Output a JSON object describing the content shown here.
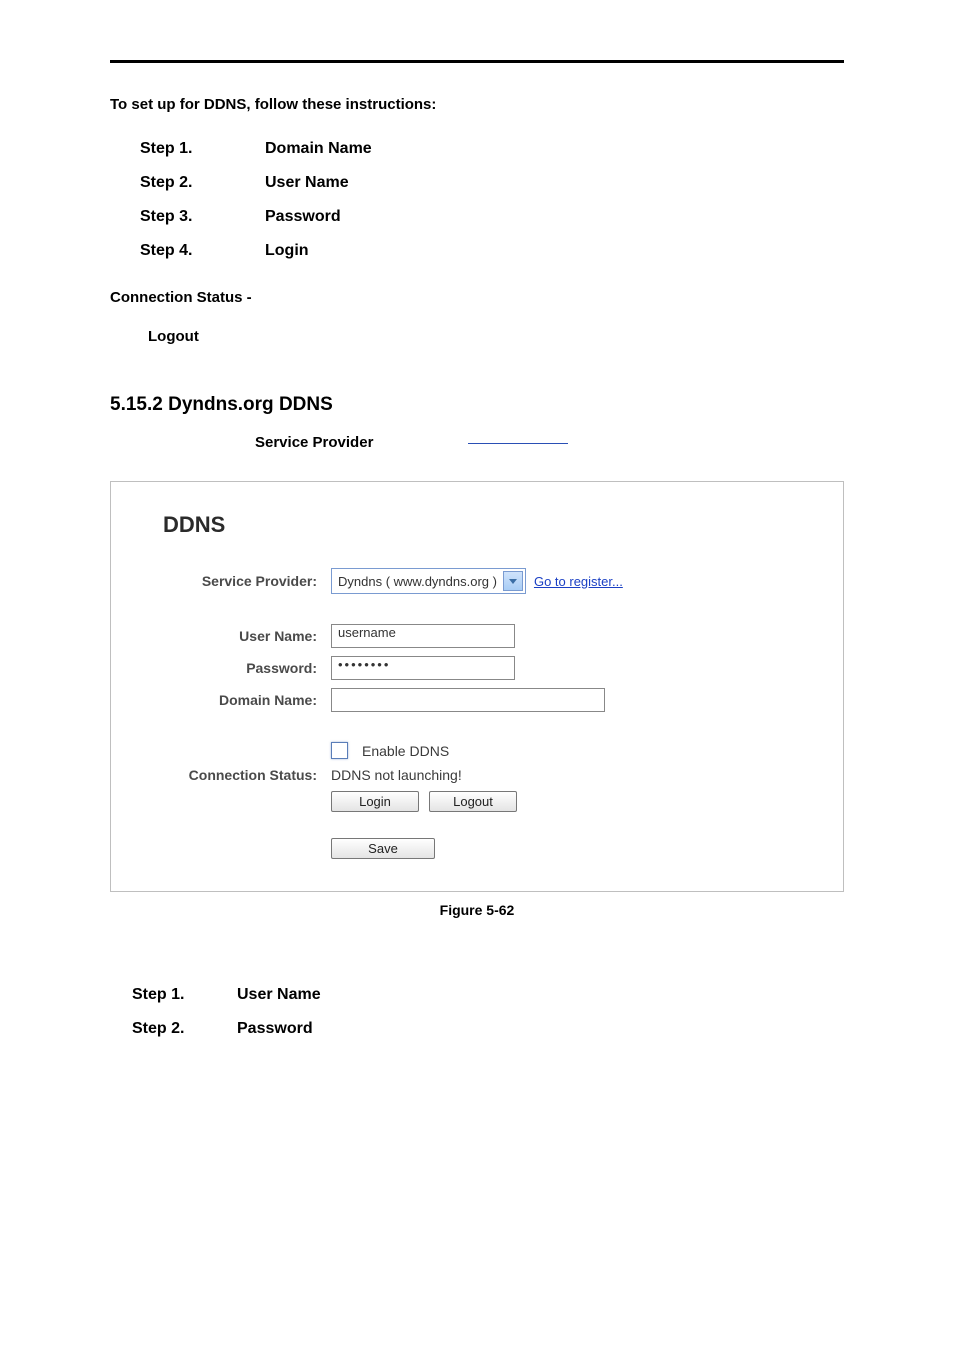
{
  "intro": {
    "heading": "To set up for DDNS, follow these instructions:",
    "steps": [
      {
        "label": "Step 1.",
        "value": "Domain Name"
      },
      {
        "label": "Step 2.",
        "value": "User Name"
      },
      {
        "label": "Step 3.",
        "value": "Password"
      },
      {
        "label": "Step 4.",
        "value": "Login"
      }
    ],
    "conn_status_label": "Connection Status -",
    "logout_label": "Logout"
  },
  "section": {
    "heading": "5.15.2 Dyndns.org DDNS",
    "sp_label": "Service Provider"
  },
  "panel": {
    "title": "DDNS",
    "sp_label": "Service Provider:",
    "sp_value": "Dyndns ( www.dyndns.org )",
    "register_link": "Go to register...",
    "user_label": "User Name:",
    "user_value": "username",
    "pass_label": "Password:",
    "pass_value": "••••••••",
    "domain_label": "Domain Name:",
    "domain_value": "",
    "enable_label": "Enable DDNS",
    "conn_label": "Connection Status:",
    "conn_value": "DDNS not launching!",
    "login_btn": "Login",
    "logout_btn": "Logout",
    "save_btn": "Save"
  },
  "figure_caption": "Figure 5-62",
  "postlude": {
    "steps": [
      {
        "label": "Step 1.",
        "value": "User Name"
      },
      {
        "label": "Step 2.",
        "value": "Password"
      }
    ]
  }
}
